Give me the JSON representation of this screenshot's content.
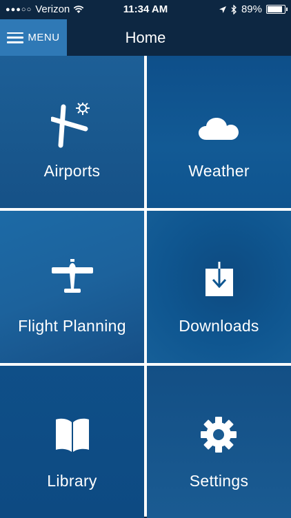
{
  "status_bar": {
    "carrier": "Verizon",
    "time": "11:34 AM",
    "battery": "89%",
    "battery_level": 0.89
  },
  "nav": {
    "menu_label": "MENU",
    "title": "Home"
  },
  "tiles": [
    {
      "label": "Airports",
      "icon": "airport-icon"
    },
    {
      "label": "Weather",
      "icon": "cloud-icon"
    },
    {
      "label": "Flight Planning",
      "icon": "airplane-icon"
    },
    {
      "label": "Downloads",
      "icon": "download-icon"
    },
    {
      "label": "Library",
      "icon": "book-icon"
    },
    {
      "label": "Settings",
      "icon": "gear-icon"
    }
  ],
  "colors": {
    "nav_background": "#0d2742",
    "menu_button": "#2f79b6",
    "tile_blue": "#165187",
    "divider": "#ffffff"
  }
}
